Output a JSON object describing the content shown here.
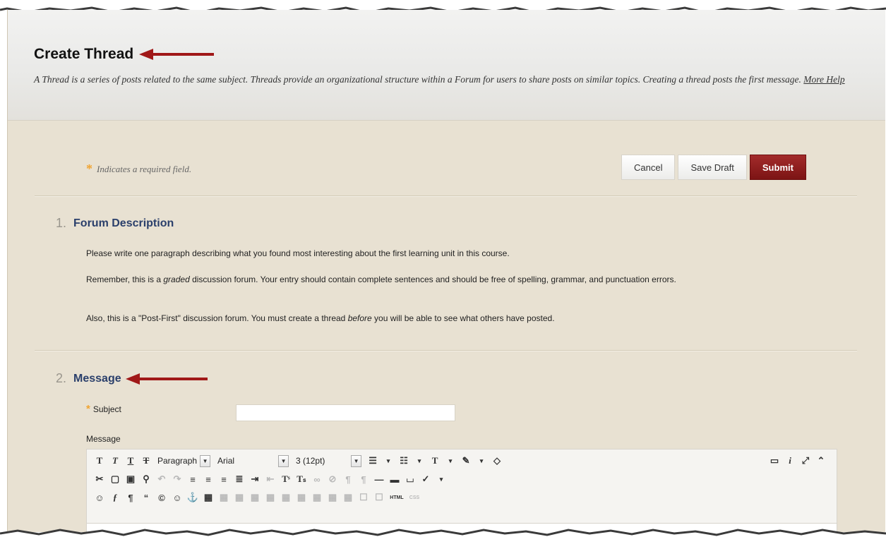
{
  "page": {
    "title": "Create Thread",
    "description_main": "A Thread is a series of posts related to the same subject. Threads provide an organizational structure within a Forum for users to share posts on similar topics. Creating a thread posts the first message.",
    "more_help": "More Help"
  },
  "required": {
    "star": "*",
    "text": "Indicates a required field."
  },
  "actions": {
    "cancel": "Cancel",
    "save_draft": "Save Draft",
    "submit": "Submit"
  },
  "section1": {
    "number": "1.",
    "title": "Forum Description",
    "p1": "Please write one paragraph describing what you found most interesting about the first learning unit in this course.",
    "p2_a": "Remember, this is a ",
    "p2_em": "graded",
    "p2_b": " discussion forum. Your entry should contain complete sentences and should be free of spelling, grammar, and punctuation errors.",
    "p3_a": "Also, this is a \"Post-First\" discussion forum. You must create a thread ",
    "p3_em": "before",
    "p3_b": " you will be able to see what others have posted."
  },
  "section2": {
    "number": "2.",
    "title": "Message",
    "subject_label": "Subject",
    "subject_value": "",
    "message_label": "Message"
  },
  "toolbar": {
    "paragraph": "Paragraph",
    "font": "Arial",
    "size": "3 (12pt)"
  },
  "colors": {
    "submit": "#8b1a1a",
    "arrow": "#a01818",
    "accent_title": "#2a3f6b",
    "background": "#e8e1d2"
  }
}
